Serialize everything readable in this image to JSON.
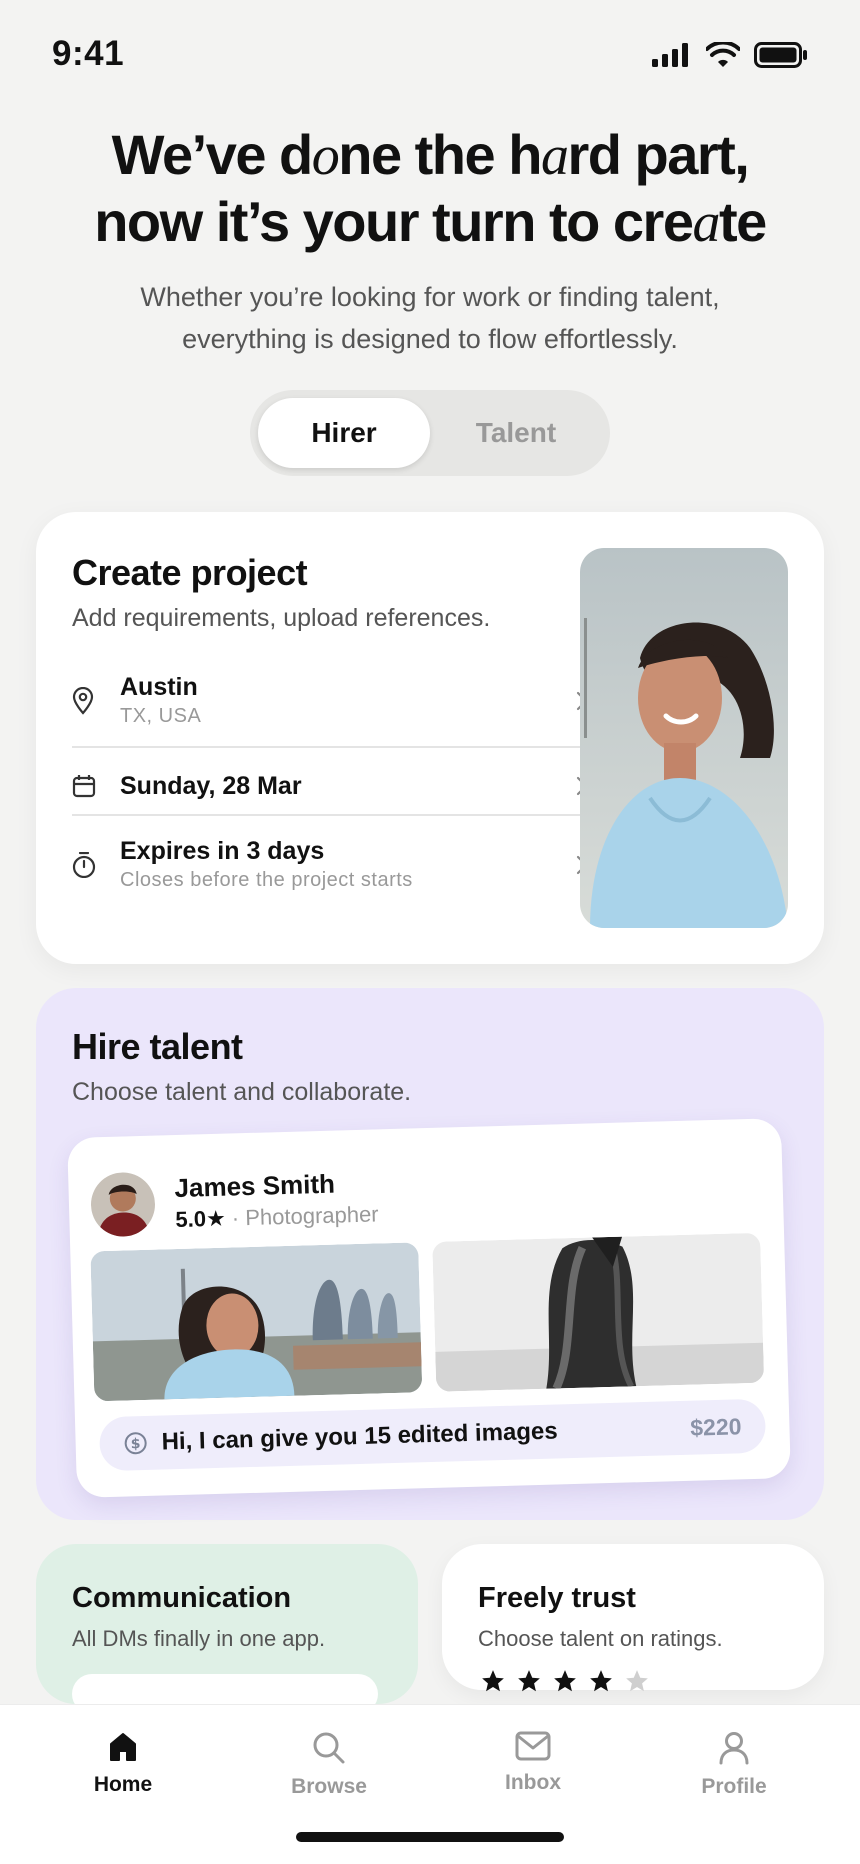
{
  "status_bar": {
    "time": "9:41"
  },
  "hero": {
    "line1_a": "We’ve d",
    "line1_b": "o",
    "line1_c": "ne the h",
    "line1_d": "a",
    "line1_e": "rd part,",
    "line2_a": "now it’s your turn to cre",
    "line2_b": "a",
    "line2_c": "te",
    "subtitle_line1": "Whether you’re looking for work or finding talent,",
    "subtitle_line2": "everything is designed to flow effortlessly."
  },
  "mode_toggle": {
    "selected": "Hirer",
    "options": [
      "Hirer",
      "Talent"
    ]
  },
  "create_project": {
    "title": "Create project",
    "subtitle": "Add requirements, upload references.",
    "location": {
      "main": "Austin",
      "secondary": "TX, USA"
    },
    "date": {
      "main": "Sunday, 28 Mar"
    },
    "expiry": {
      "main": "Expires in 3 days",
      "secondary": "Closes before the project starts"
    }
  },
  "hire_talent": {
    "title": "Hire talent",
    "subtitle": "Choose talent and collaborate.",
    "talent": {
      "name": "James Smith",
      "rating": "5.0★",
      "role": "· Photographer",
      "message": "Hi, I can give you 15 edited images",
      "price": "$220"
    }
  },
  "communication": {
    "title": "Communication",
    "subtitle": "All DMs finally in one app."
  },
  "trust": {
    "title": "Freely trust",
    "subtitle": "Choose talent on ratings."
  },
  "tabbar": {
    "active": "Home",
    "items": [
      "Home",
      "Browse",
      "Inbox",
      "Profile"
    ]
  },
  "colors": {
    "background": "#f3f3f2",
    "hire_card": "#ebe6fb",
    "communication_card": "#dff0e6",
    "price": "#8b93a8"
  }
}
